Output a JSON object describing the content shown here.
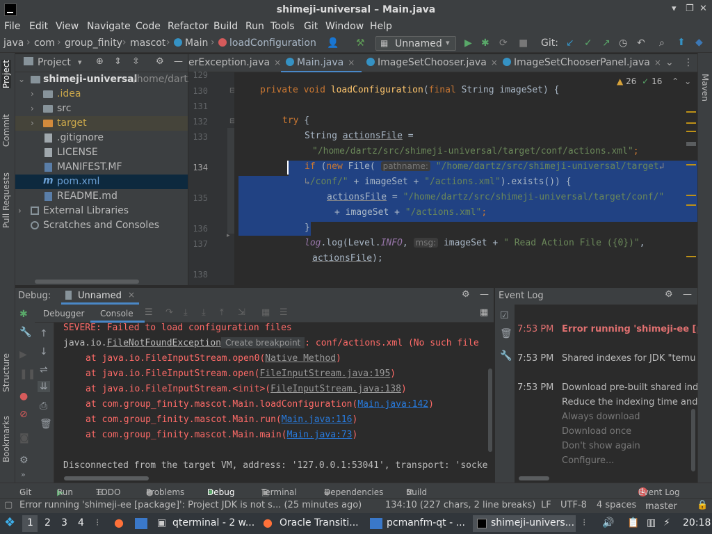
{
  "window": {
    "title": "shimeji-universal – Main.java"
  },
  "menu": [
    "File",
    "Edit",
    "View",
    "Navigate",
    "Code",
    "Refactor",
    "Build",
    "Run",
    "Tools",
    "Git",
    "Window",
    "Help"
  ],
  "nav": {
    "crumbs": [
      "java",
      "com",
      "group_finity",
      "mascot",
      "Main",
      "loadConfiguration"
    ],
    "run_config": "Unnamed",
    "git_label": "Git:"
  },
  "project": {
    "header": "Project",
    "tree": [
      {
        "label": "shimeji-universal",
        "suffix": "/home/dartz",
        "kind": "root"
      },
      {
        "label": ".idea",
        "kind": "folder"
      },
      {
        "label": "src",
        "kind": "folder"
      },
      {
        "label": "target",
        "kind": "folder-orange"
      },
      {
        "label": ".gitignore",
        "kind": "file"
      },
      {
        "label": "LICENSE",
        "kind": "file"
      },
      {
        "label": "MANIFEST.MF",
        "kind": "file"
      },
      {
        "label": "pom.xml",
        "kind": "file"
      },
      {
        "label": "README.md",
        "kind": "file"
      },
      {
        "label": "External Libraries",
        "kind": "lib"
      },
      {
        "label": "Scratches and Consoles",
        "kind": "scratch"
      }
    ]
  },
  "left_stripe": [
    "Project",
    "Commit",
    "Pull Requests",
    "Structure",
    "Bookmarks"
  ],
  "right_stripe": [
    "Maven"
  ],
  "editor": {
    "tabs": [
      "erException.java",
      "Main.java",
      "ImageSetChooser.java",
      "ImageSetChooserPanel.java"
    ],
    "inspections": {
      "warnings": "26",
      "ok": "16"
    },
    "lines": [
      "129",
      "130",
      "131",
      "132",
      "133",
      "134",
      "135",
      "136",
      "137",
      "138"
    ],
    "code": {
      "l130_kw": "private void ",
      "l130_fn": "loadConfiguration",
      "l130_rest1": "(",
      "l130_kw2": "final ",
      "l130_rest2": "String imageSet) {",
      "l132_kw": "try",
      "l132_rest": " {",
      "l133a": "String ",
      "l133b": "actionsFile",
      "l133c": " =",
      "l133_str": "\"/home/dartz/src/shimeji-universal/target/conf/actions.xml\"",
      "l133_end": ";",
      "l134_kw": "if",
      "l134_a": " (",
      "l134_kw2": "new ",
      "l134_b": "File(",
      "l134_hint": "pathname:",
      "l134_str": "\"/home/dartz/src/shimeji-universal/target",
      "l134w_str": "/conf/\"",
      "l134w_a": " + imageSet + ",
      "l134w_str2": "\"/actions.xml\"",
      "l134w_b": ").exists()) {",
      "l135a": "actionsFile",
      "l135b": " = ",
      "l135_str": "\"/home/dartz/src/shimeji-universal/target/conf/\"",
      "l135w_a": "+ imageSet + ",
      "l135w_str": "\"/actions.xml\"",
      "l135w_b": ";",
      "l136": "}",
      "l137_it": "log",
      "l137_a": ".log(Level.",
      "l137_it2": "INFO",
      "l137_b": ",",
      "l137_hint": "msg:",
      "l137_c": "imageSet + ",
      "l137_str": "\" Read Action File ({0})\"",
      "l137_d": ",",
      "l137w": "actionsFile",
      "l137w_b": ");"
    }
  },
  "debug": {
    "label": "Debug:",
    "session": "Unnamed",
    "tabs": [
      "Debugger",
      "Console"
    ],
    "console": {
      "l1": "SEVERE: Failed to load configuration files",
      "l2a": "java.io.",
      "l2link": "FileNotFoundException",
      "l2tip": "Create breakpoint",
      "l2b": ": conf/actions.xml (No such file",
      "stack": [
        {
          "pre": "at java.io.FileInputStream.open0(",
          "link": "Native Method",
          "post": ")"
        },
        {
          "pre": "at java.io.FileInputStream.open(",
          "link": "FileInputStream.java:195",
          "post": ")"
        },
        {
          "pre": "at java.io.FileInputStream.<init>(",
          "link": "FileInputStream.java:138",
          "post": ")"
        },
        {
          "pre": "at com.group_finity.mascot.Main.loadConfiguration(",
          "link": "Main.java:142",
          "post": ")"
        },
        {
          "pre": "at com.group_finity.mascot.Main.run(",
          "link": "Main.java:116",
          "post": ")"
        },
        {
          "pre": "at com.group_finity.mascot.Main.main(",
          "link": "Main.java:73",
          "post": ")"
        }
      ],
      "disconnect": "Disconnected from the target VM, address: '127.0.0.1:53041', transport: 'socke"
    }
  },
  "event_log": {
    "title": "Event Log",
    "entries": [
      {
        "time": "7:53 PM",
        "text": "Error running 'shimeji-ee [p"
      },
      {
        "time": "7:53 PM",
        "text": "Shared indexes for JDK \"temu"
      },
      {
        "time": "7:53 PM",
        "text": "Download pre-built shared ind",
        "extra": "Reduce the indexing time and"
      }
    ],
    "actions": [
      "Always download",
      "Download once",
      "Don't show again",
      "Configure..."
    ]
  },
  "tool_tabs": [
    "Git",
    "Run",
    "TODO",
    "Problems",
    "Debug",
    "Terminal",
    "Dependencies",
    "Build"
  ],
  "event_log_tab": {
    "badge": "1",
    "label": "Event Log"
  },
  "status": {
    "message": "Error running 'shimeji-ee [package]': Project JDK is not s... (25 minutes ago)",
    "position": "134:10 (227 chars, 2 line breaks)",
    "line_sep": "LF",
    "encoding": "UTF-8",
    "indent": "4 spaces",
    "branch": "master"
  },
  "taskbar": {
    "desktops": [
      "1",
      "2",
      "3",
      "4"
    ],
    "apps": [
      "qterminal - 2 w...",
      "Oracle Transiti...",
      "pcmanfm-qt - ...",
      "shimeji-univers..."
    ],
    "clock": "20:18"
  },
  "colors": {
    "accent": "#4a88c7",
    "selection": "#214283",
    "error": "#ff6b68",
    "link": "#287bde"
  }
}
